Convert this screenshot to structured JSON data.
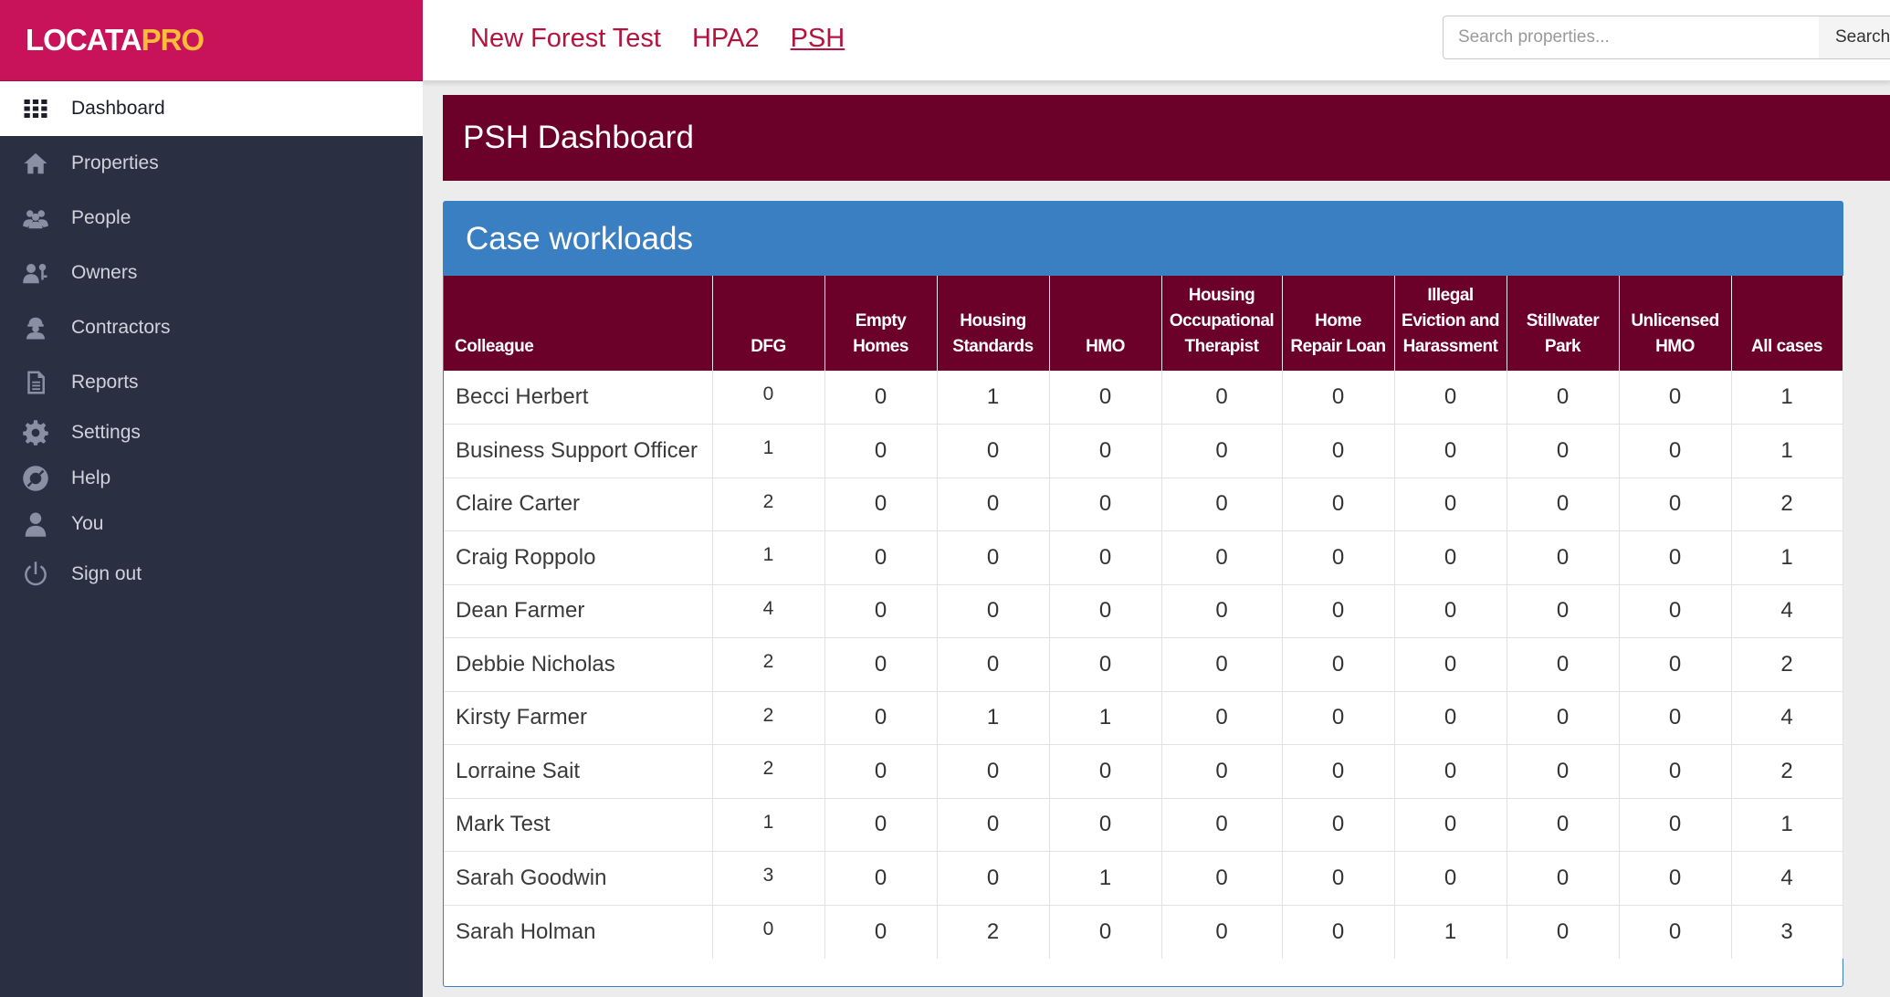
{
  "brand": {
    "name_main": "LOCATA",
    "name_suffix": "PRO"
  },
  "sidebar": {
    "items": [
      {
        "label": "Dashboard",
        "icon": "grid-icon",
        "active": true
      },
      {
        "label": "Properties",
        "icon": "house-icon"
      },
      {
        "label": "People",
        "icon": "people-icon"
      },
      {
        "label": "Owners",
        "icon": "owner-icon"
      },
      {
        "label": "Contractors",
        "icon": "contractor-icon"
      },
      {
        "label": "Reports",
        "icon": "document-icon"
      },
      {
        "label": "Settings",
        "icon": "gear-icon"
      },
      {
        "label": "Help",
        "icon": "lifebuoy-icon"
      },
      {
        "label": "You",
        "icon": "user-icon"
      },
      {
        "label": "Sign out",
        "icon": "power-icon"
      }
    ]
  },
  "topnav": {
    "links": [
      {
        "label": "New Forest Test"
      },
      {
        "label": "HPA2"
      },
      {
        "label": "PSH",
        "current": true
      }
    ]
  },
  "search": {
    "placeholder": "Search properties...",
    "button_label": "Search"
  },
  "page": {
    "title": "PSH Dashboard"
  },
  "panel": {
    "title": "Case workloads"
  },
  "table": {
    "headers": [
      [
        "Colleague"
      ],
      [
        "DFG"
      ],
      [
        "Empty",
        "Homes"
      ],
      [
        "Housing",
        "Standards"
      ],
      [
        "HMO"
      ],
      [
        "Housing",
        "Occupational",
        "Therapist"
      ],
      [
        "Home",
        "Repair Loan"
      ],
      [
        "Illegal",
        "Eviction and",
        "Harassment"
      ],
      [
        "Stillwater",
        "Park"
      ],
      [
        "Unlicensed",
        "HMO"
      ],
      [
        "All cases"
      ]
    ],
    "rows": [
      [
        "Becci Herbert",
        "0",
        "0",
        "1",
        "0",
        "0",
        "0",
        "0",
        "0",
        "0",
        "1"
      ],
      [
        "Business Support Officer",
        "1",
        "0",
        "0",
        "0",
        "0",
        "0",
        "0",
        "0",
        "0",
        "1"
      ],
      [
        "Claire Carter",
        "2",
        "0",
        "0",
        "0",
        "0",
        "0",
        "0",
        "0",
        "0",
        "2"
      ],
      [
        "Craig Roppolo",
        "1",
        "0",
        "0",
        "0",
        "0",
        "0",
        "0",
        "0",
        "0",
        "1"
      ],
      [
        "Dean Farmer",
        "4",
        "0",
        "0",
        "0",
        "0",
        "0",
        "0",
        "0",
        "0",
        "4"
      ],
      [
        "Debbie Nicholas",
        "2",
        "0",
        "0",
        "0",
        "0",
        "0",
        "0",
        "0",
        "0",
        "2"
      ],
      [
        "Kirsty Farmer",
        "2",
        "0",
        "1",
        "1",
        "0",
        "0",
        "0",
        "0",
        "0",
        "4"
      ],
      [
        "Lorraine Sait",
        "2",
        "0",
        "0",
        "0",
        "0",
        "0",
        "0",
        "0",
        "0",
        "2"
      ],
      [
        "Mark Test",
        "1",
        "0",
        "0",
        "0",
        "0",
        "0",
        "0",
        "0",
        "0",
        "1"
      ],
      [
        "Sarah Goodwin",
        "3",
        "0",
        "0",
        "1",
        "0",
        "0",
        "0",
        "0",
        "0",
        "4"
      ],
      [
        "Sarah Holman",
        "0",
        "0",
        "2",
        "0",
        "0",
        "0",
        "1",
        "0",
        "0",
        "3"
      ]
    ]
  },
  "colors": {
    "brand_pink": "#c8135a",
    "brand_orange": "#ffbb3a",
    "sidebar_bg": "#2b2f42",
    "header_maroon": "#6b0128",
    "panel_blue": "#3a7fc1",
    "link_red": "#b5133e"
  }
}
